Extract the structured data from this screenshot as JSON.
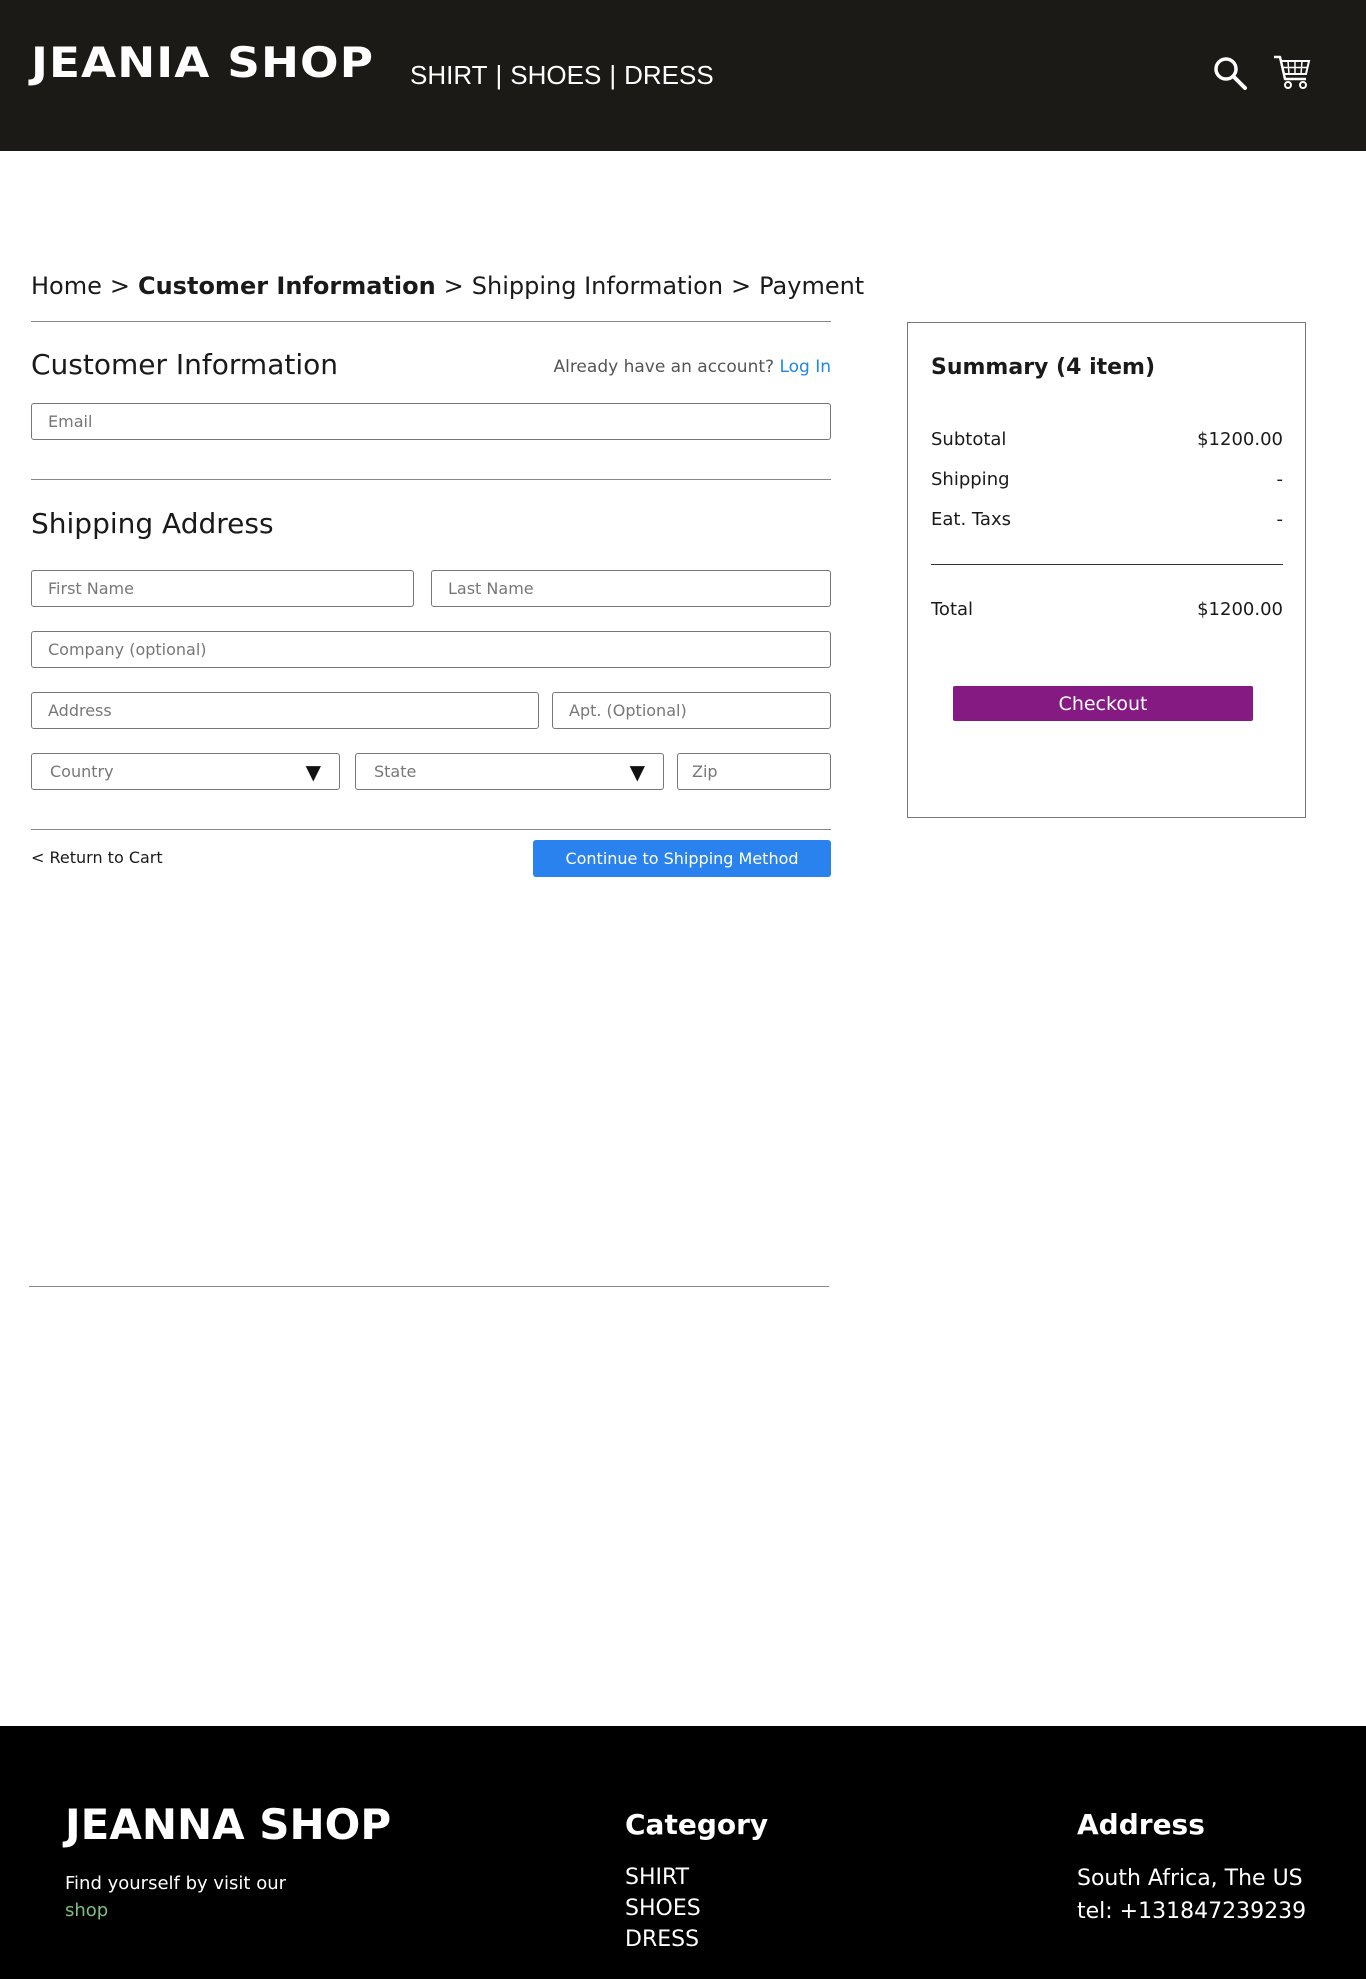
{
  "header": {
    "logo": "JEANIA SHOP",
    "nav": [
      "SHIRT",
      "|",
      "SHOES",
      "|",
      "DRESS"
    ],
    "icons": [
      "search-icon",
      "cart-icon"
    ]
  },
  "breadcrumb": {
    "items": [
      "Home",
      "Customer Information",
      "Shipping Information",
      "Payment"
    ],
    "separator": ">"
  },
  "customer_info": {
    "title": "Customer Information",
    "account_prompt": "Already have an account?",
    "login_link": "Log In",
    "email_placeholder": "Email"
  },
  "shipping": {
    "title": "Shipping Address",
    "first_name": "First Name",
    "last_name": "Last Name",
    "company": "Company (optional)",
    "address": "Address",
    "apt": "Apt. (Optional)",
    "country": "Country",
    "state": "State",
    "zip": "Zip"
  },
  "actions": {
    "return": "< Return to Cart",
    "continue": "Continue to Shipping Method"
  },
  "summary": {
    "title": "Summary (4 item)",
    "rows": [
      {
        "label": "Subtotal",
        "value": "$1200.00"
      },
      {
        "label": "Shipping",
        "value": "-"
      },
      {
        "label": "Eat. Taxs",
        "value": "-"
      }
    ],
    "total_label": "Total",
    "total_value": "$1200.00",
    "checkout": "Checkout"
  },
  "footer": {
    "logo": "JEANNA SHOP",
    "tagline": "Find yourself by visit our",
    "shop_link": "shop",
    "category_title": "Category",
    "categories": [
      "SHIRT",
      "SHOES",
      "DRESS"
    ],
    "address_title": "Address",
    "address_line": "South Africa, The US",
    "tel": "tel: +131847239239"
  },
  "colors": {
    "header_bg": "#1c1a17",
    "primary_button": "#2a82ee",
    "checkout_button": "#861a83",
    "link": "#1e88e5",
    "shop_link": "#7fbf7f"
  }
}
